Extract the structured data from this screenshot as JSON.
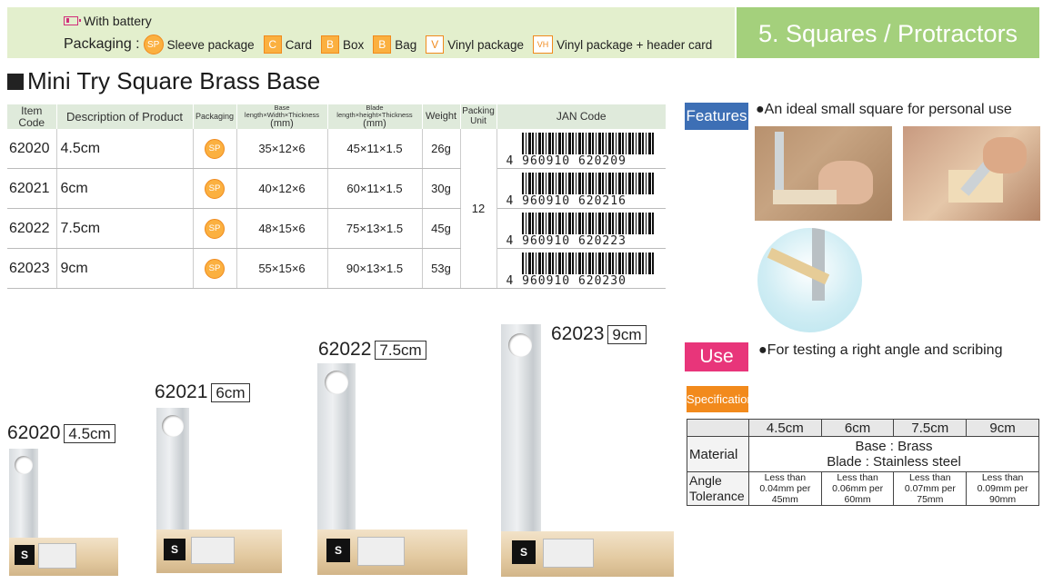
{
  "header": {
    "battery": "With battery",
    "packaging_label": "Packaging :",
    "packaging": [
      {
        "icon": "SP",
        "label": "Sleeve package"
      },
      {
        "icon": "C",
        "label": "Card"
      },
      {
        "icon": "B",
        "label": "Box"
      },
      {
        "icon": "B",
        "label": "Bag"
      },
      {
        "icon": "V",
        "label": "Vinyl package"
      },
      {
        "icon": "VH",
        "label": "Vinyl package + header card"
      }
    ],
    "category": "5. Squares / Protractors"
  },
  "title": "Mini Try Square Brass Base",
  "table": {
    "headers": {
      "code": "Item Code",
      "desc": "Description of Product",
      "pack": "Packaging",
      "base": "Base length×Width×Thickness",
      "blade": "Blade length×height×Thickness",
      "mm": "(mm)",
      "weight": "Weight",
      "unit": "Packing Unit",
      "jan": "JAN Code"
    },
    "packing_unit": "12",
    "rows": [
      {
        "code": "62020",
        "desc": "4.5cm",
        "pack": "SP",
        "base": "35×12×6",
        "blade": "45×11×1.5",
        "weight": "26g",
        "jan": "4 960910 620209"
      },
      {
        "code": "62021",
        "desc": "6cm",
        "pack": "SP",
        "base": "40×12×6",
        "blade": "60×11×1.5",
        "weight": "30g",
        "jan": "4 960910 620216"
      },
      {
        "code": "62022",
        "desc": "7.5cm",
        "pack": "SP",
        "base": "48×15×6",
        "blade": "75×13×1.5",
        "weight": "45g",
        "jan": "4 960910 620223"
      },
      {
        "code": "62023",
        "desc": "9cm",
        "pack": "SP",
        "base": "55×15×6",
        "blade": "90×13×1.5",
        "weight": "53g",
        "jan": "4 960910 620230"
      }
    ]
  },
  "products": [
    {
      "code": "62020",
      "size": "4.5cm"
    },
    {
      "code": "62021",
      "size": "6cm"
    },
    {
      "code": "62022",
      "size": "7.5cm"
    },
    {
      "code": "62023",
      "size": "9cm"
    }
  ],
  "features": {
    "tag": "Features",
    "text": "●An ideal small square for personal use"
  },
  "use": {
    "tag": "Use",
    "text": "●For testing a right angle and scribing"
  },
  "spec": {
    "tag": "Specifications",
    "sizes": [
      "4.5cm",
      "6cm",
      "7.5cm",
      "9cm"
    ],
    "material_label": "Material",
    "material_base": "Base : Brass",
    "material_blade": "Blade : Stainless steel",
    "tolerance_label": "Angle Tolerance",
    "tolerance_prefix": "Less than",
    "tolerances": [
      "0.04mm per 45mm",
      "0.06mm per 60mm",
      "0.07mm per 75mm",
      "0.09mm per 90mm"
    ]
  }
}
